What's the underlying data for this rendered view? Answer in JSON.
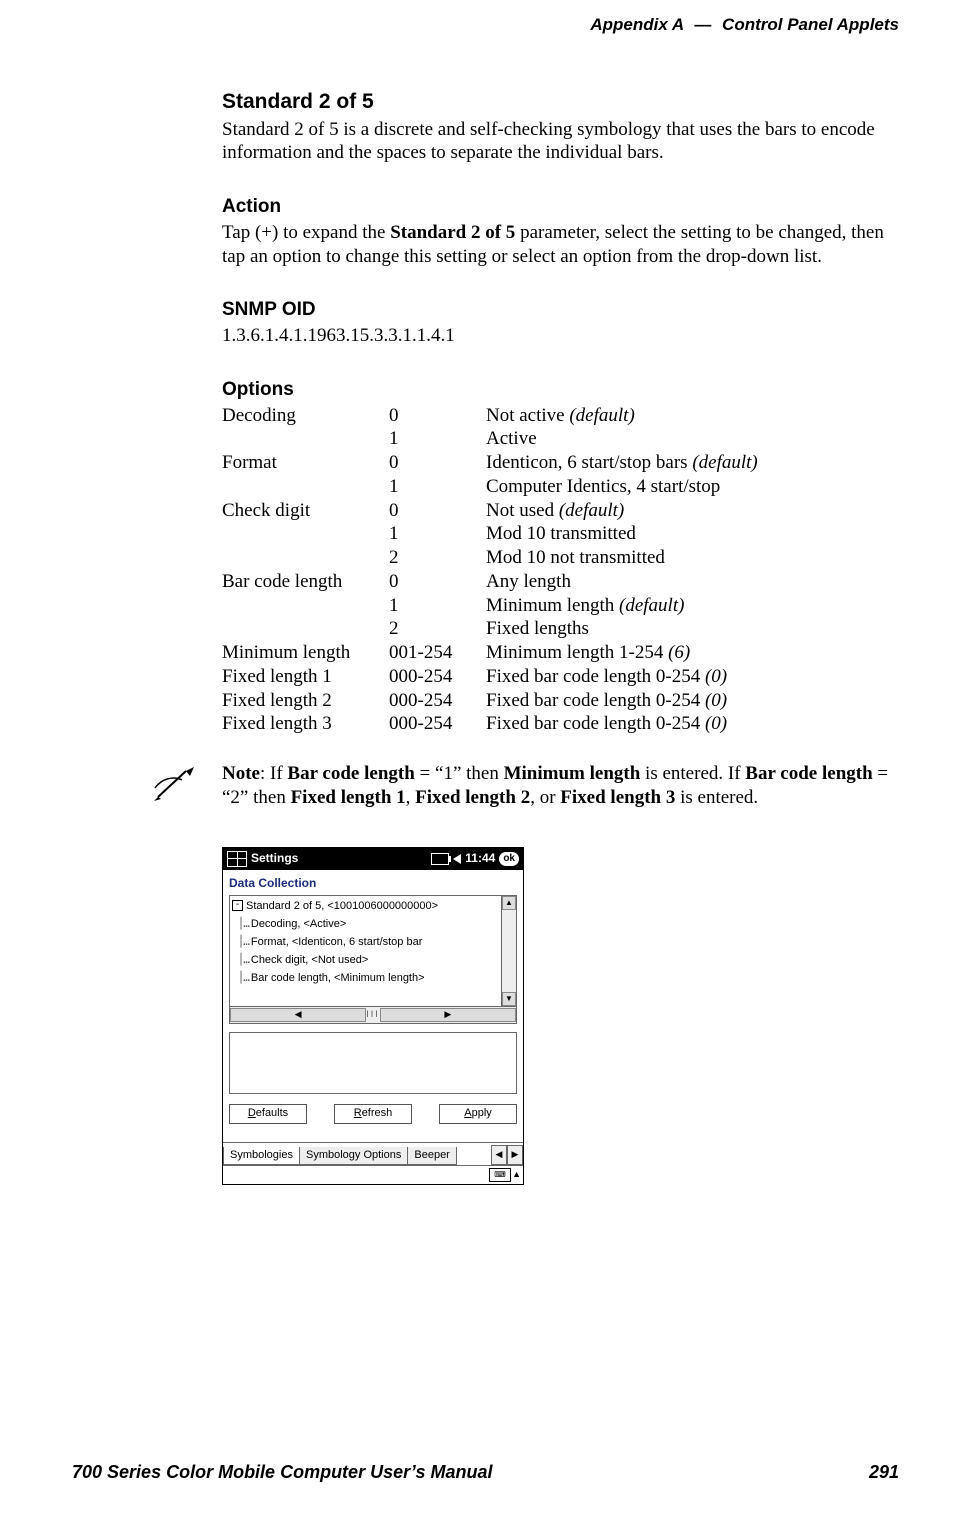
{
  "header": {
    "appendix": "Appendix A",
    "separator": "—",
    "title": "Control Panel Applets"
  },
  "section": {
    "title": "Standard 2 of 5",
    "intro": "Standard 2 of 5 is a discrete and self-checking symbology that uses the bars to encode information and the spaces to separate the individual bars."
  },
  "action": {
    "heading": "Action",
    "pre": "Tap (+) to expand the ",
    "bold": "Standard 2 of 5",
    "post": " parameter, select the setting to be changed, then tap an option to change this setting or select an option from the drop-down list."
  },
  "snmp": {
    "heading": "SNMP OID",
    "value": "1.3.6.1.4.1.1963.15.3.3.1.1.4.1"
  },
  "options": {
    "heading": "Options",
    "rows": [
      {
        "name": "Decoding",
        "code": "0",
        "desc": "Not active ",
        "defaultTag": "(default)"
      },
      {
        "name": "",
        "code": "1",
        "desc": "Active"
      },
      {
        "name": "Format",
        "code": "0",
        "desc": "Identicon, 6 start/stop bars ",
        "defaultTag": "(default)"
      },
      {
        "name": "",
        "code": "1",
        "desc": "Computer Identics, 4 start/stop"
      },
      {
        "name": "Check digit",
        "code": "0",
        "desc": "Not used ",
        "defaultTag": "(default)"
      },
      {
        "name": "",
        "code": "1",
        "desc": "Mod 10 transmitted"
      },
      {
        "name": "",
        "code": "2",
        "desc": "Mod 10 not transmitted"
      },
      {
        "name": "Bar code length",
        "code": "0",
        "desc": "Any length"
      },
      {
        "name": "",
        "code": "1",
        "desc": "Minimum length ",
        "defaultTag": "(default)"
      },
      {
        "name": "",
        "code": "2",
        "desc": "Fixed lengths"
      },
      {
        "name": "Minimum length",
        "code": "001-254",
        "desc": "Minimum length 1-254 ",
        "defaultTag": "(6)"
      },
      {
        "name": "Fixed length 1",
        "code": "000-254",
        "desc": "Fixed bar code length 0-254 ",
        "defaultTag": "(0)"
      },
      {
        "name": "Fixed length 2",
        "code": "000-254",
        "desc": "Fixed bar code length 0-254 ",
        "defaultTag": "(0)"
      },
      {
        "name": "Fixed length 3",
        "code": "000-254",
        "desc": "Fixed bar code length 0-254 ",
        "defaultTag": "(0)"
      }
    ]
  },
  "note": {
    "lead": "Note",
    "seg1": ": If ",
    "b1": "Bar code length",
    "seg2": " = “1” then ",
    "b2": "Minimum length",
    "seg3": " is entered. If ",
    "b3": "Bar code length",
    "seg4": " = “2” then ",
    "b4": "Fixed length 1",
    "seg5": ", ",
    "b5": "Fixed length 2",
    "seg6": ", or ",
    "b6": "Fixed length 3",
    "seg7": " is entered."
  },
  "pda": {
    "title": "Settings",
    "time": "11:44",
    "ok": "ok",
    "panel": "Data Collection",
    "tree": {
      "root": "Standard 2 of 5, <1001006000000000>",
      "items": [
        "Decoding, <Active>",
        "Format, <Identicon, 6 start/stop bar",
        "Check digit, <Not used>",
        "Bar code length, <Minimum length>"
      ]
    },
    "buttons": {
      "defaults": "Defaults",
      "refresh": "Refresh",
      "apply": "Apply"
    },
    "tabs": {
      "t1": "Symbologies",
      "t2": "Symbology Options",
      "t3": "Beeper"
    }
  },
  "footer": {
    "left": "700 Series Color Mobile Computer User’s Manual",
    "right": "291"
  }
}
